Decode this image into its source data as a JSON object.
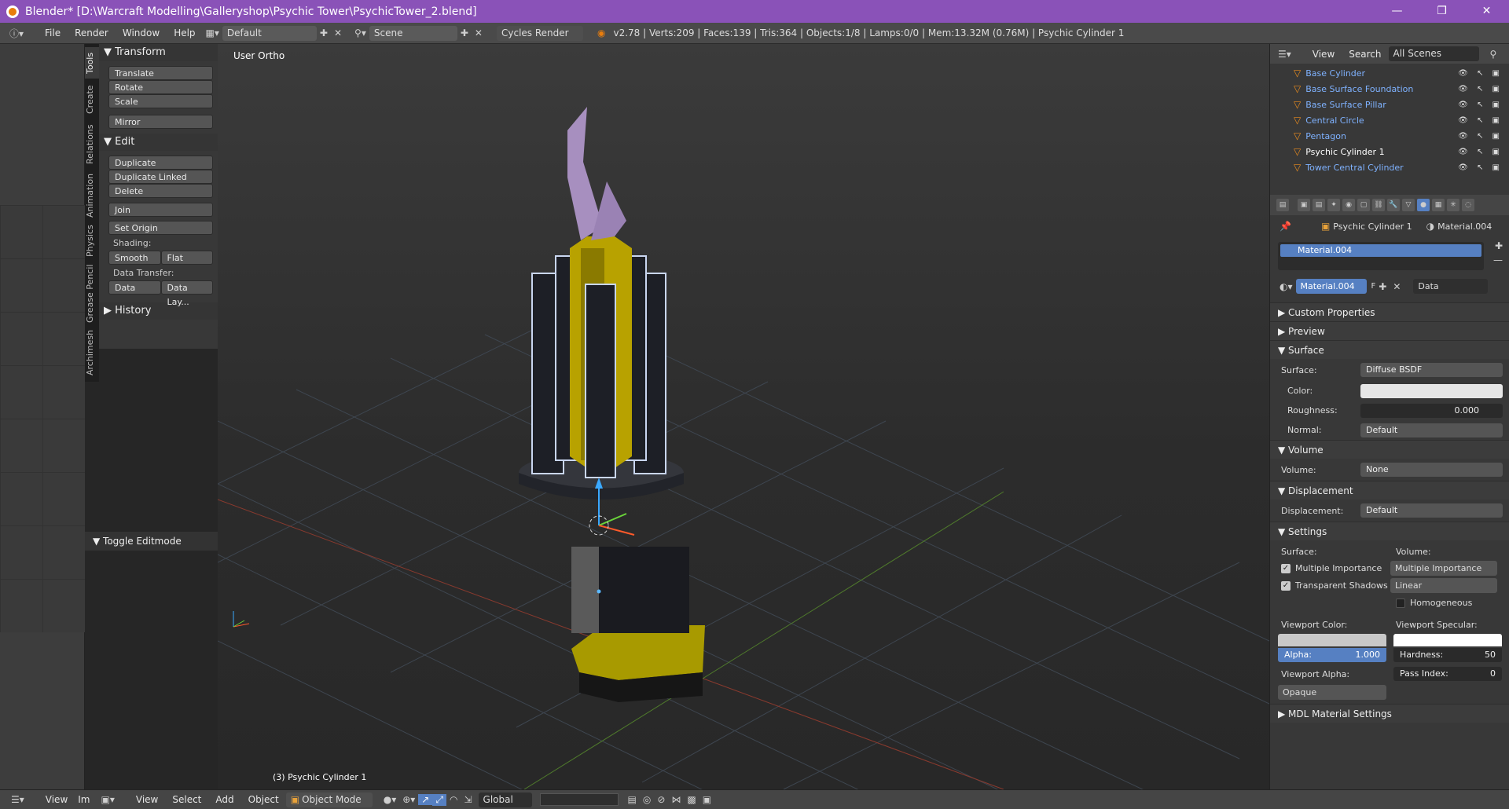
{
  "window": {
    "title": "Blender* [D:\\Warcraft Modelling\\Galleryshop\\Psychic Tower\\PsychicTower_2.blend]",
    "minimize": "—",
    "maximize": "❐",
    "close": "✕"
  },
  "infobar": {
    "menus": [
      "File",
      "Render",
      "Window",
      "Help"
    ],
    "screen_layout": "Default",
    "scene": "Scene",
    "render_engine": "Cycles Render",
    "stats": "v2.78 | Verts:209 | Faces:139 | Tris:364 | Objects:1/8 | Lamps:0/0 | Mem:13.32M (0.76M) | Psychic Cylinder 1"
  },
  "tool_tabs": [
    "Tools",
    "Create",
    "Relations",
    "Animation",
    "Physics",
    "Grease Pencil",
    "Archimesh"
  ],
  "tools": {
    "transform_title": "Transform",
    "translate": "Translate",
    "rotate": "Rotate",
    "scale": "Scale",
    "mirror": "Mirror",
    "edit_title": "Edit",
    "duplicate": "Duplicate",
    "duplicate_linked": "Duplicate Linked",
    "delete": "Delete",
    "join": "Join",
    "set_origin": "Set Origin",
    "shading_label": "Shading:",
    "smooth": "Smooth",
    "flat": "Flat",
    "data_transfer_label": "Data Transfer:",
    "data": "Data",
    "data_layouts": "Data Lay...",
    "history_title": "History",
    "toggle_editmode": "Toggle Editmode"
  },
  "viewport": {
    "view_label": "User Ortho",
    "object_label": "(3) Psychic Cylinder 1"
  },
  "outliner": {
    "view": "View",
    "search": "Search",
    "filter": "All Scenes",
    "items": [
      {
        "name": "Base Cylinder"
      },
      {
        "name": "Base Surface Foundation"
      },
      {
        "name": "Base Surface Pillar"
      },
      {
        "name": "Central Circle"
      },
      {
        "name": "Pentagon"
      },
      {
        "name": "Psychic Cylinder 1"
      },
      {
        "name": "Tower Central Cylinder"
      }
    ]
  },
  "properties": {
    "breadcrumb_object": "Psychic Cylinder 1",
    "breadcrumb_material": "Material.004",
    "slot_name": "Material.004",
    "material_name": "Material.004",
    "fake_user": "F",
    "link_mode": "Data",
    "sections": {
      "custom_properties": "Custom Properties",
      "preview": "Preview",
      "surface": "Surface",
      "volume": "Volume",
      "displacement": "Displacement",
      "settings": "Settings",
      "mdl": "MDL Material Settings"
    },
    "surface_label": "Surface:",
    "surface_value": "Diffuse BSDF",
    "color_label": "Color:",
    "roughness_label": "Roughness:",
    "roughness_value": "0.000",
    "normal_label": "Normal:",
    "normal_value": "Default",
    "volume_label": "Volume:",
    "volume_value": "None",
    "displacement_label": "Displacement:",
    "displacement_value": "Default",
    "settings_surface_label": "Surface:",
    "settings_volume_label": "Volume:",
    "multiple_importance": "Multiple Importance",
    "transparent_shadows": "Transparent Shadows",
    "volume_sampling": "Multiple Importance",
    "volume_interp": "Linear",
    "homogeneous": "Homogeneous",
    "viewport_color_label": "Viewport Color:",
    "viewport_specular_label": "Viewport Specular:",
    "alpha": "Alpha:",
    "alpha_value": "1.000",
    "hardness": "Hardness:",
    "hardness_value": "50",
    "viewport_alpha_label": "Viewport Alpha:",
    "viewport_alpha_value": "Opaque",
    "pass_index": "Pass Index:",
    "pass_index_value": "0"
  },
  "bottombar": {
    "view": "View",
    "im": "Im",
    "view2": "View",
    "select": "Select",
    "add": "Add",
    "object": "Object",
    "mode": "Object Mode",
    "orientation": "Global"
  },
  "colors": {
    "title_bar": "#8a52b8",
    "tower_yellow": "#b8a200",
    "crystal": "#a78fbf",
    "pillar_dark": "#1d1f26"
  }
}
